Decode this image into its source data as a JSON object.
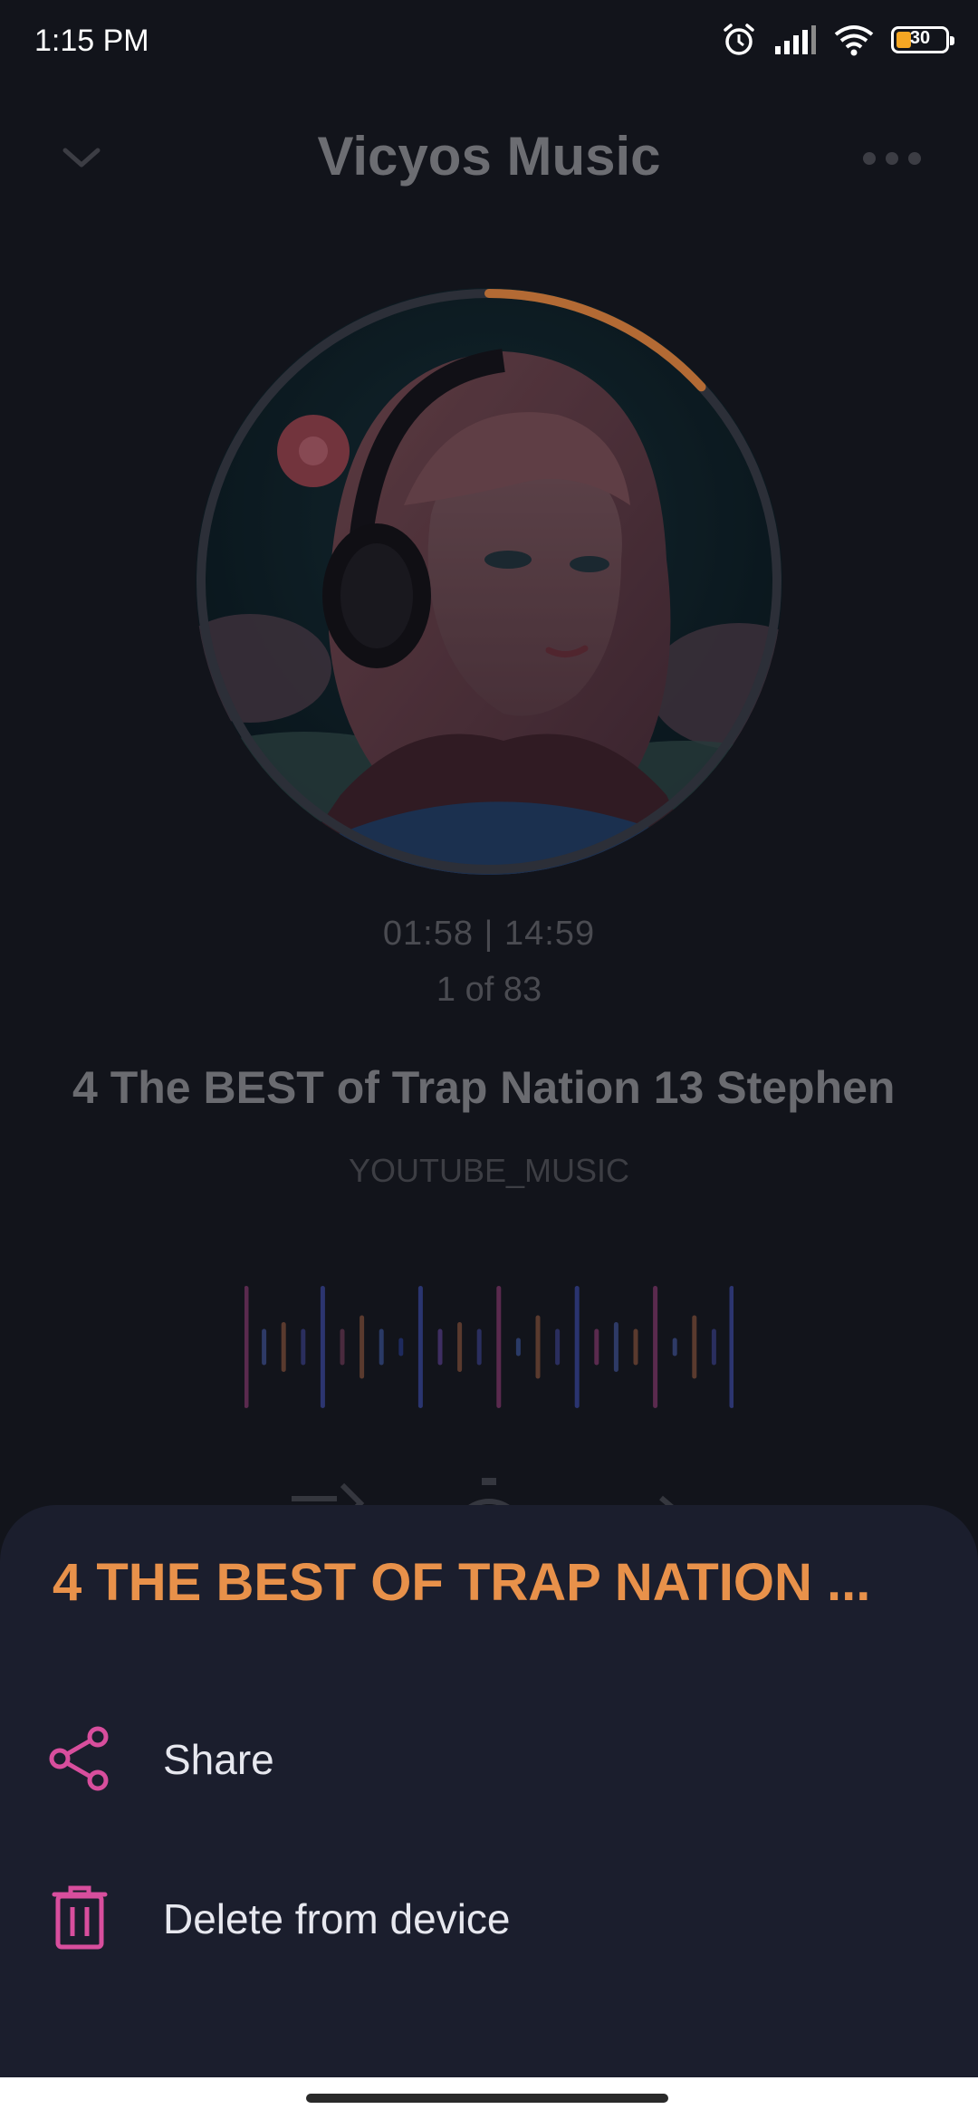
{
  "status_bar": {
    "time": "1:15 PM",
    "battery_level": "30",
    "icons": [
      "alarm-icon",
      "signal-icon",
      "wifi-icon",
      "battery-icon"
    ]
  },
  "header": {
    "title": "Vicyos Music",
    "left_icon": "chevron-down-icon",
    "right_icon": "more-horizontal-icon"
  },
  "player": {
    "time_display": "01:58 | 14:59",
    "position": "1 of 83",
    "track_title": "4 The BEST of Trap Nation 13  Stephen",
    "source": "YOUTUBE_MUSIC",
    "progress_fraction": 0.132
  },
  "bottom_sheet": {
    "title": "4 THE BEST OF TRAP NATION ...",
    "items": [
      {
        "label": "Share",
        "icon": "share-icon"
      },
      {
        "label": "Delete from device",
        "icon": "trash-icon"
      }
    ]
  },
  "colors": {
    "accent_orange": "#e8914a",
    "accent_pink": "#d84e9d",
    "sheet_bg": "#1b1e2d",
    "screen_bg": "#12141b"
  }
}
